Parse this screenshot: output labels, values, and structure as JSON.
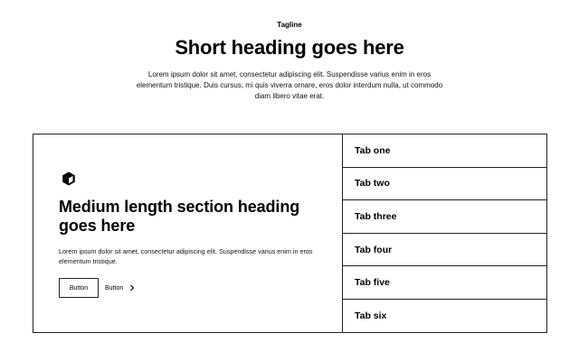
{
  "header": {
    "tagline": "Tagline",
    "title": "Short heading goes here",
    "intro": "Lorem ipsum dolor sit amet, consectetur adipiscing elit. Suspendisse varius enim in eros elementum tristique. Duis cursus, mi quis viverra ornare, eros dolor interdum nulla, ut commodo diam libero vitae erat."
  },
  "section": {
    "icon": "cube-icon",
    "heading": "Medium length section heading goes here",
    "text": "Lorem ipsum dolor sit amet, consectetur adipiscing elit. Suspendisse varius enim in eros elementum tristique.",
    "primary_button": "Button",
    "link_button": "Button",
    "link_icon": "chevron-right-icon"
  },
  "tabs": [
    {
      "label": "Tab one"
    },
    {
      "label": "Tab two"
    },
    {
      "label": "Tab three"
    },
    {
      "label": "Tab four"
    },
    {
      "label": "Tab five"
    },
    {
      "label": "Tab six"
    }
  ]
}
